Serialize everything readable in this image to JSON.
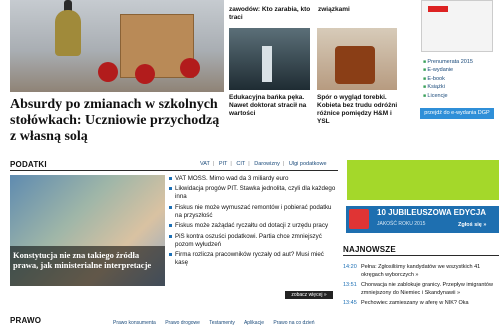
{
  "hero": {
    "title": "Absurdy po zmianach w szkolnych stołówkach: Uczniowie przychodzą z własną solą"
  },
  "top_snippets": {
    "a": "zawodów: Kto zarabia, kto traci",
    "b": "związkami"
  },
  "thumbs": [
    {
      "caption": "Edukacyjna bańka pęka. Nawet doktorat stracił na wartości"
    },
    {
      "caption": "Spór o wygląd torebki. Kobieta bez trudu odróżni różnice pomiędzy H&M i YSL"
    }
  ],
  "magazine": {
    "items": [
      "Prenumerata 2015",
      "E-wydanie",
      "E-book",
      "Książki",
      "Licencje"
    ],
    "button": "przejdź do e-wydania DGP"
  },
  "podatki": {
    "heading": "PODATKI",
    "tabs": [
      "VAT",
      "PIT",
      "CIT",
      "Darowizny",
      "Ulgi podatkowe"
    ],
    "image_title": "Konstytucja nie zna takiego źródła prawa, jak ministerialne interpretacje",
    "news": [
      "VAT MOSS. Mimo wad da 3 miliardy euro",
      "Likwidacja progów PIT. Stawka jednolita, czyli dla każdego inna",
      "Fiskus nie może wymuszać remontów i pobierać podatku na przyszłość",
      "Fiskus może zażądać ryczałtu od dotacji z urzędu pracy",
      "PiS kontra oszuści podatkowi. Partia chce zmniejszyć pozom wyłudzeń",
      "Firma rozlicza pracowników ryczały od aut? Musi mieć kasę"
    ],
    "more": "zobacz więcej »"
  },
  "edition": {
    "title": "10 JUBILEUSZOWA EDYCJA",
    "subtitle": "JAKOŚĆ ROKU 2015",
    "cta": "Zgłoś się »"
  },
  "najnowsze": {
    "heading": "NAJNOWSZE",
    "items": [
      {
        "time": "14:20",
        "text": "Pełna: Zgłosiliśmy kandydatów we wszystkich 41 okręgach wyborczych »"
      },
      {
        "time": "13:51",
        "text": "Chorwacja nie zablokuje granicy. Przepływ imigrantów zmniejszony do Niemiec i Skandynawii »"
      },
      {
        "time": "13:45",
        "text": "Pechowiec zamieszany w aferę w NIK? Oka"
      }
    ]
  },
  "prawo": {
    "heading": "PRAWO",
    "tabs": [
      "Prawo konsumenta",
      "Prawo drogowe",
      "Testamenty",
      "Aplikacje",
      "Prawo na co dzień"
    ]
  }
}
